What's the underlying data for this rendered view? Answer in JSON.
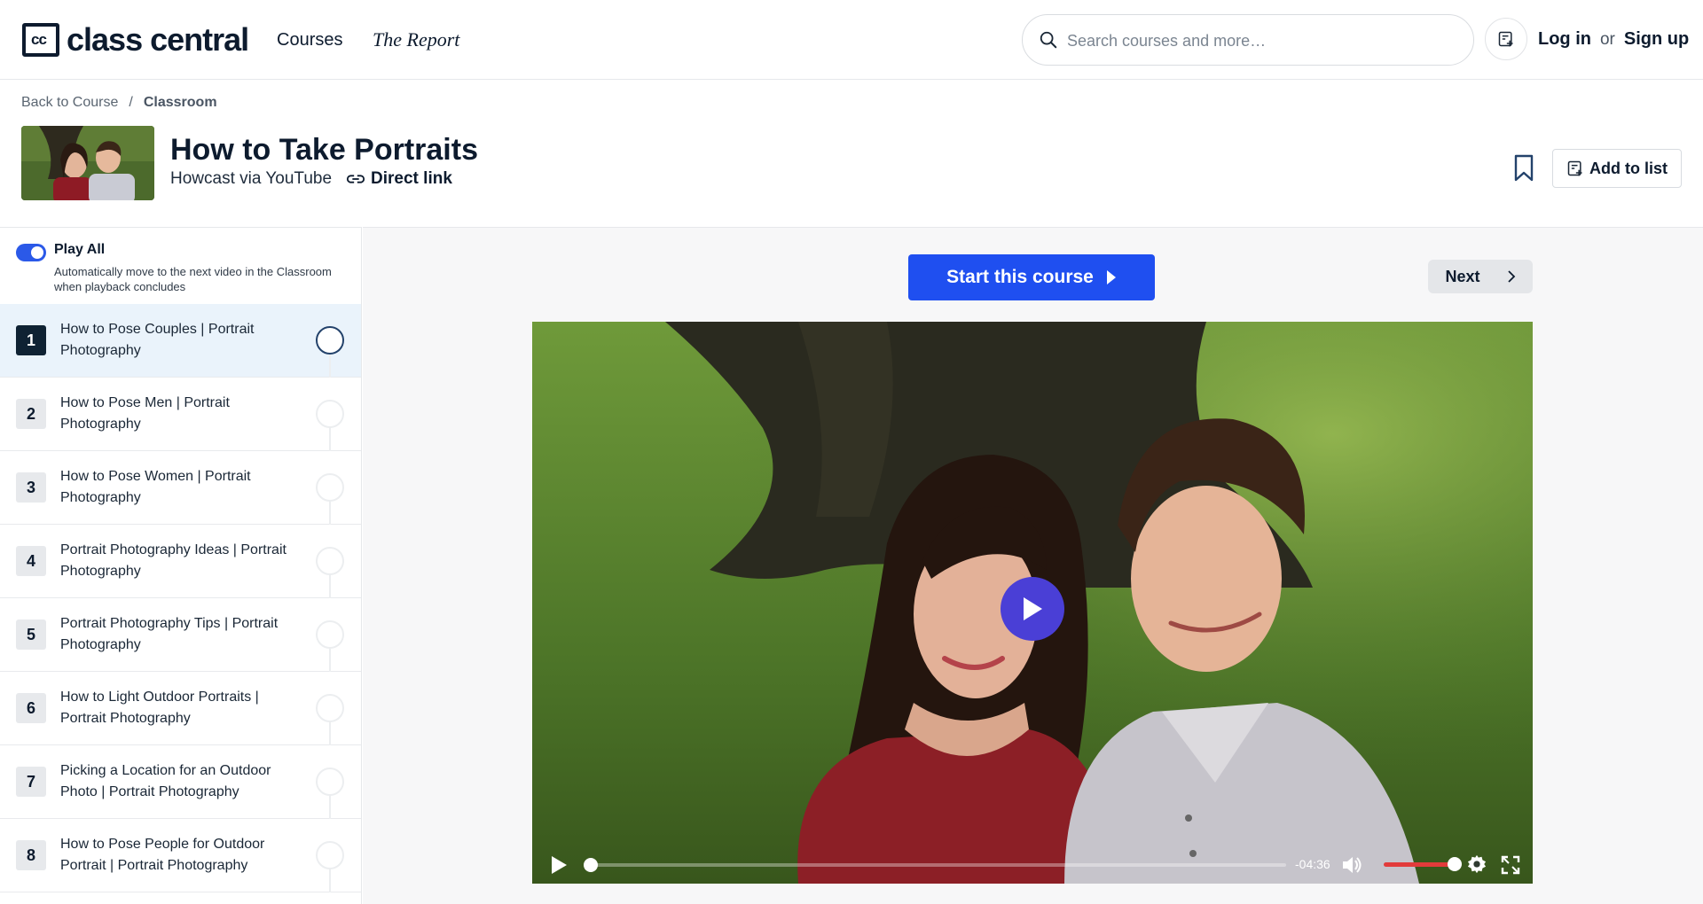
{
  "header": {
    "logo_mark": "cc",
    "logo_text": "class central",
    "nav": {
      "courses": "Courses",
      "report": "The Report"
    },
    "search": {
      "placeholder": "Search courses and more…"
    },
    "auth": {
      "login": "Log in",
      "or": "or",
      "signup": "Sign up"
    }
  },
  "breadcrumb": {
    "back": "Back to Course",
    "separator": "/",
    "current": "Classroom"
  },
  "course": {
    "title": "How to Take Portraits",
    "provider": "Howcast via YouTube",
    "direct_link": "Direct link",
    "add_to_list": "Add to list"
  },
  "sidebar": {
    "play_all": {
      "title": "Play All",
      "description": "Automatically move to the next video in the Classroom when playback concludes",
      "enabled": true
    },
    "lessons": [
      {
        "num": "1",
        "title": "How to Pose Couples | Portrait Photography",
        "active": true
      },
      {
        "num": "2",
        "title": "How to Pose Men | Portrait Photography"
      },
      {
        "num": "3",
        "title": "How to Pose Women | Portrait Photography"
      },
      {
        "num": "4",
        "title": "Portrait Photography Ideas | Portrait Photography"
      },
      {
        "num": "5",
        "title": "Portrait Photography Tips | Portrait Photography"
      },
      {
        "num": "6",
        "title": "How to Light Outdoor Portraits | Portrait Photography"
      },
      {
        "num": "7",
        "title": "Picking a Location for an Outdoor Photo | Portrait Photography"
      },
      {
        "num": "8",
        "title": "How to Pose People for Outdoor Portrait | Portrait Photography"
      }
    ]
  },
  "main": {
    "start_button": "Start this course",
    "next_button": "Next"
  },
  "player": {
    "time_remaining": "-04:36",
    "progress": 0.0,
    "volume": 1.0
  },
  "colors": {
    "primary_blue": "#1f4ff0",
    "navy": "#0d1b2e",
    "play_button": "#4a3fd6",
    "volume_red": "#e23b3b",
    "active_lesson_bg": "#eaf3fb"
  }
}
